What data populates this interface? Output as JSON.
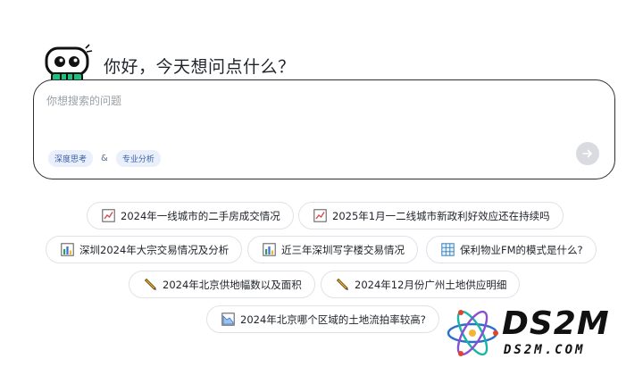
{
  "header": {
    "greeting": "你好，今天想问点什么？",
    "mascot_icon": "robot-icon"
  },
  "search": {
    "placeholder": "你想搜索的问题",
    "value": "",
    "modes": [
      {
        "label": "深度思考"
      },
      {
        "label": "专业分析"
      }
    ],
    "joiner": "&",
    "send_icon": "arrow-right-icon"
  },
  "suggestions": [
    {
      "label": "2024年一线城市的二手房成交情况",
      "icon": "line-chart-icon"
    },
    {
      "label": "2025年1月一二线城市新政利好效应还在持续吗",
      "icon": "line-chart-icon"
    },
    {
      "label": "深圳2024年大宗交易情况及分析",
      "icon": "bar-chart-icon"
    },
    {
      "label": "近三年深圳写字楼交易情况",
      "icon": "bar-chart-icon"
    },
    {
      "label": "保利物业FM的模式是什么?",
      "icon": "table-icon"
    },
    {
      "label": "2024年北京供地幅数以及面积",
      "icon": "pencil-icon"
    },
    {
      "label": "2024年12月份广州土地供应明细",
      "icon": "pencil-icon"
    },
    {
      "label": "2024年北京哪个区域的土地流拍率较高?",
      "icon": "area-chart-icon"
    }
  ],
  "watermark": {
    "brand": "DS2M",
    "domain": "DS2M.COM"
  },
  "colors": {
    "border": "#2b2f36",
    "chip_bg": "#eaf0fb",
    "chip_text": "#3b5ea8",
    "robot_green": "#19c37d",
    "chart_red": "#d94a4a",
    "chart_green": "#2e9b5f",
    "pencil_yellow": "#f2b632"
  }
}
